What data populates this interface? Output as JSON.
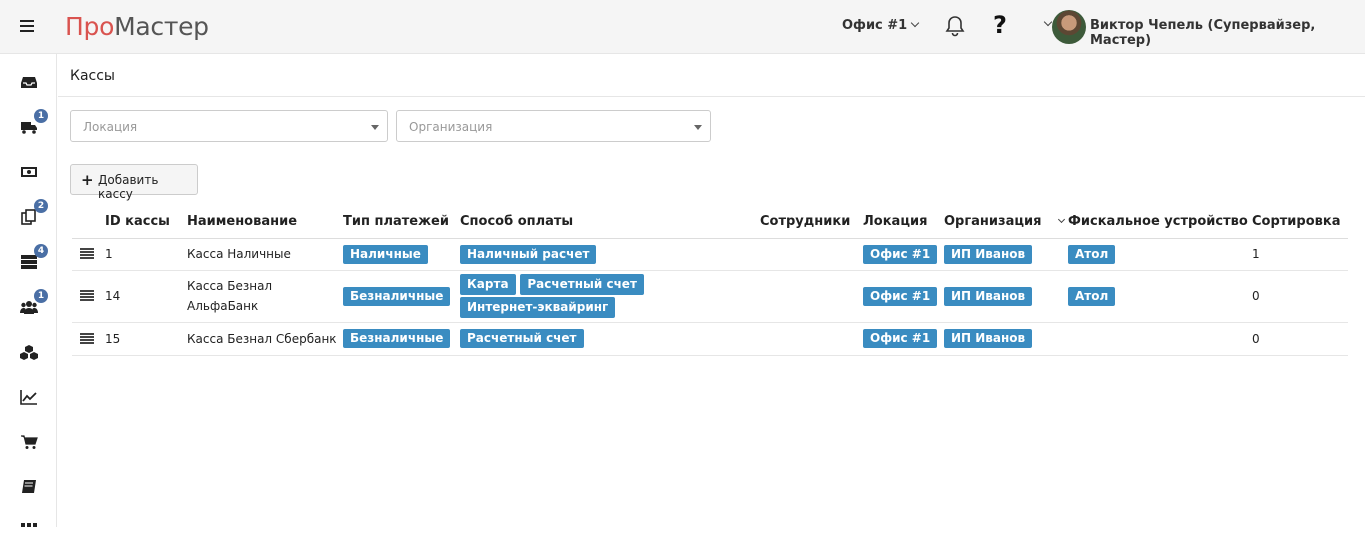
{
  "app": {
    "logo_part1": "Про",
    "logo_part2": "Мастер"
  },
  "header": {
    "office": "Офис #1",
    "help": "?",
    "user": "Виктор Чепель (Супервайзер, Мастер)"
  },
  "sidebar": {
    "items": [
      {
        "icon": "inbox-icon",
        "badge": ""
      },
      {
        "icon": "truck-icon",
        "badge": "1"
      },
      {
        "icon": "money-icon",
        "badge": ""
      },
      {
        "icon": "copy-icon",
        "badge": "2"
      },
      {
        "icon": "server-icon",
        "badge": "4"
      },
      {
        "icon": "users-icon",
        "badge": "1"
      },
      {
        "icon": "cubes-icon",
        "badge": ""
      },
      {
        "icon": "chart-icon",
        "badge": ""
      },
      {
        "icon": "cart-icon",
        "badge": ""
      },
      {
        "icon": "book-icon",
        "badge": ""
      }
    ]
  },
  "page": {
    "title": "Кассы"
  },
  "filters": {
    "location_placeholder": "Локация",
    "organization_placeholder": "Организация"
  },
  "toolbar": {
    "add_label": "Добавить кассу"
  },
  "table": {
    "columns": [
      "ID кассы",
      "Наименование",
      "Тип платежей",
      "Способ оплаты",
      "Сотрудники",
      "Локация",
      "Организация",
      "Фискальное устройство",
      "Сортировка"
    ],
    "rows": [
      {
        "id": "1",
        "name": "Касса Наличные",
        "type": "Наличные",
        "methods": [
          "Наличный расчет"
        ],
        "location": "Офис #1",
        "org": "ИП Иванов",
        "fiscal": "Атол",
        "sort": "1"
      },
      {
        "id": "14",
        "name": "Касса Безнал АльфаБанк",
        "type": "Безналичные",
        "methods": [
          "Карта",
          "Расчетный счет",
          "Интернет-эквайринг"
        ],
        "location": "Офис #1",
        "org": "ИП Иванов",
        "fiscal": "Атол",
        "sort": "0"
      },
      {
        "id": "15",
        "name": "Касса Безнал Сбербанк",
        "type": "Безналичные",
        "methods": [
          "Расчетный счет"
        ],
        "location": "Офис #1",
        "org": "ИП Иванов",
        "fiscal": "",
        "sort": "0"
      }
    ]
  },
  "colors": {
    "tag": "#3a8cc1",
    "badge": "#4a6fa5",
    "logo_accent": "#d9534f"
  }
}
